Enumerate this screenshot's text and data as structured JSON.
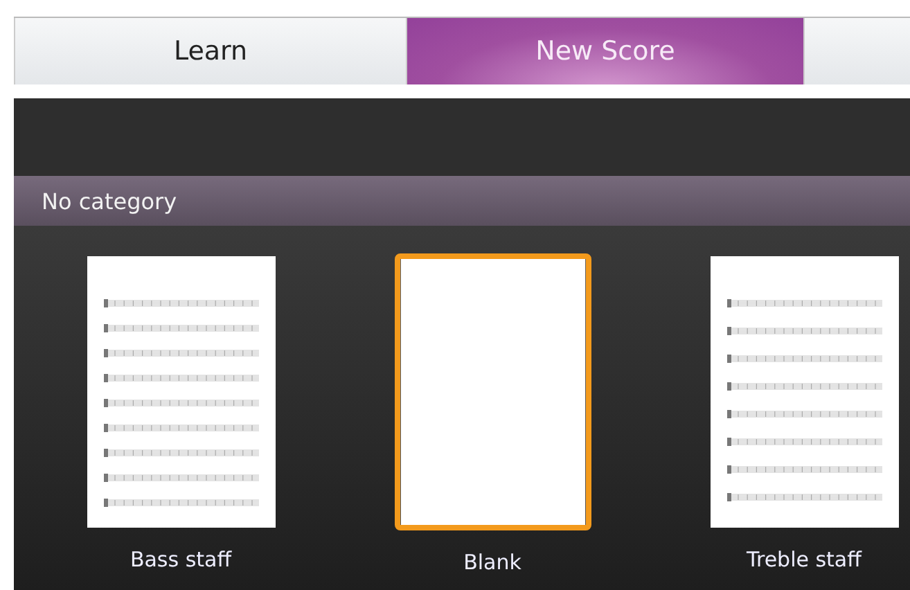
{
  "tabs": [
    {
      "label": "Learn",
      "selected": false
    },
    {
      "label": "New Score",
      "selected": true
    }
  ],
  "category": {
    "title": "No category"
  },
  "templates": [
    {
      "kind": "bass",
      "label": "Bass staff",
      "selected": false
    },
    {
      "kind": "blank",
      "label": "Blank",
      "selected": true
    },
    {
      "kind": "treble",
      "label": "Treble staff",
      "selected": false
    }
  ]
}
